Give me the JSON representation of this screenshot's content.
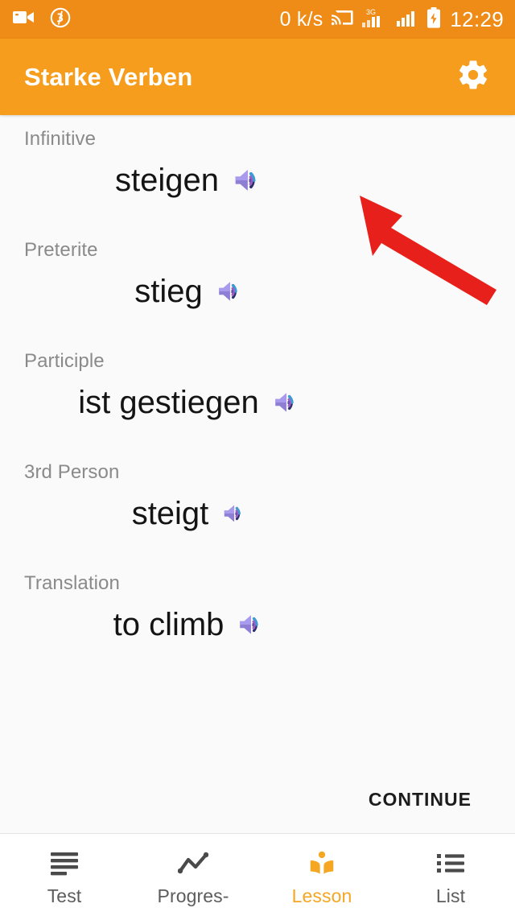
{
  "status_bar": {
    "network_speed": "0 k/s",
    "clock": "12:29",
    "left_icons": [
      "video-camera-icon",
      "bitcoin-circle-icon"
    ],
    "right_icons": [
      "cast-icon",
      "signal-3g-icon",
      "signal-bars-icon",
      "battery-charging-icon"
    ],
    "signal_label": "3G",
    "background": "#ef8c17"
  },
  "app_bar": {
    "title": "Starke Verben",
    "settings_icon": "gear-icon",
    "background": "#f79d1e",
    "text_color": "#ffffff"
  },
  "lesson": {
    "fields": [
      {
        "label": "Infinitive",
        "value": "steigen",
        "speaker_icon": "speaker-icon"
      },
      {
        "label": "Preterite",
        "value": "stieg",
        "speaker_icon": "speaker-icon"
      },
      {
        "label": "Participle",
        "value": "ist gestiegen",
        "speaker_icon": "speaker-icon"
      },
      {
        "label": "3rd Person",
        "value": "steigt",
        "speaker_icon": "speaker-icon"
      },
      {
        "label": "Translation",
        "value": "to climb",
        "speaker_icon": "speaker-icon"
      }
    ],
    "continue_label": "CONTINUE"
  },
  "bottom_nav": {
    "active_color": "#f5a623",
    "inactive_color": "#5c5c5c",
    "items": [
      {
        "label": "Test",
        "icon": "subject-lines-icon",
        "active": false
      },
      {
        "label": "Progres-",
        "icon": "trending-line-icon",
        "active": false
      },
      {
        "label": "Lesson",
        "icon": "local-library-icon",
        "active": true
      },
      {
        "label": "List",
        "icon": "bulleted-list-icon",
        "active": false
      }
    ]
  },
  "annotation": {
    "arrow_color": "#e8201b",
    "arrow_points_to": "speaker-icon next to steigen"
  }
}
